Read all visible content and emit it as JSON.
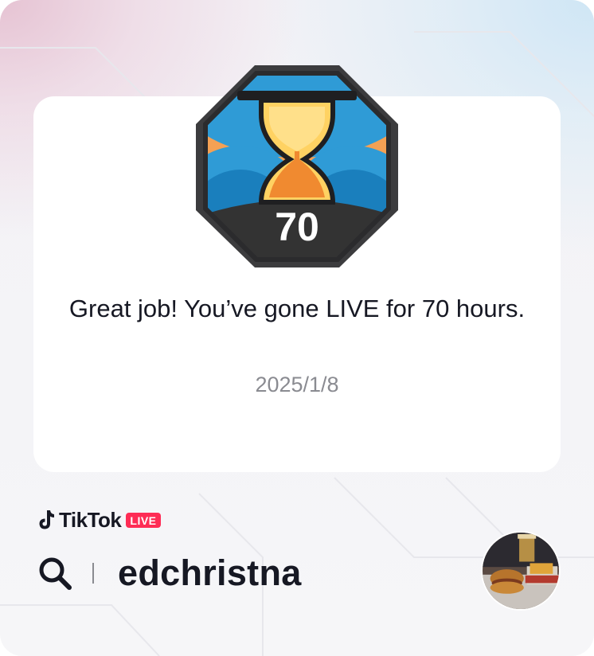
{
  "card": {
    "badge_number": "70",
    "message": "Great job! You’ve gone LIVE for 70 hours.",
    "date": "2025/1/8"
  },
  "brand": {
    "name": "TikTok",
    "live_label": "LIVE"
  },
  "search": {
    "username": "edchristna"
  },
  "colors": {
    "badge_outline": "#3c3c3e",
    "badge_blue": "#2f9bd6",
    "badge_orange": "#f5a154",
    "hourglass_gold": "#ffd262",
    "live_red": "#fe2c55",
    "text_primary": "#161823",
    "text_secondary": "#8a8b91"
  },
  "icons": [
    "hourglass-icon",
    "tiktok-logo-icon",
    "search-icon"
  ]
}
